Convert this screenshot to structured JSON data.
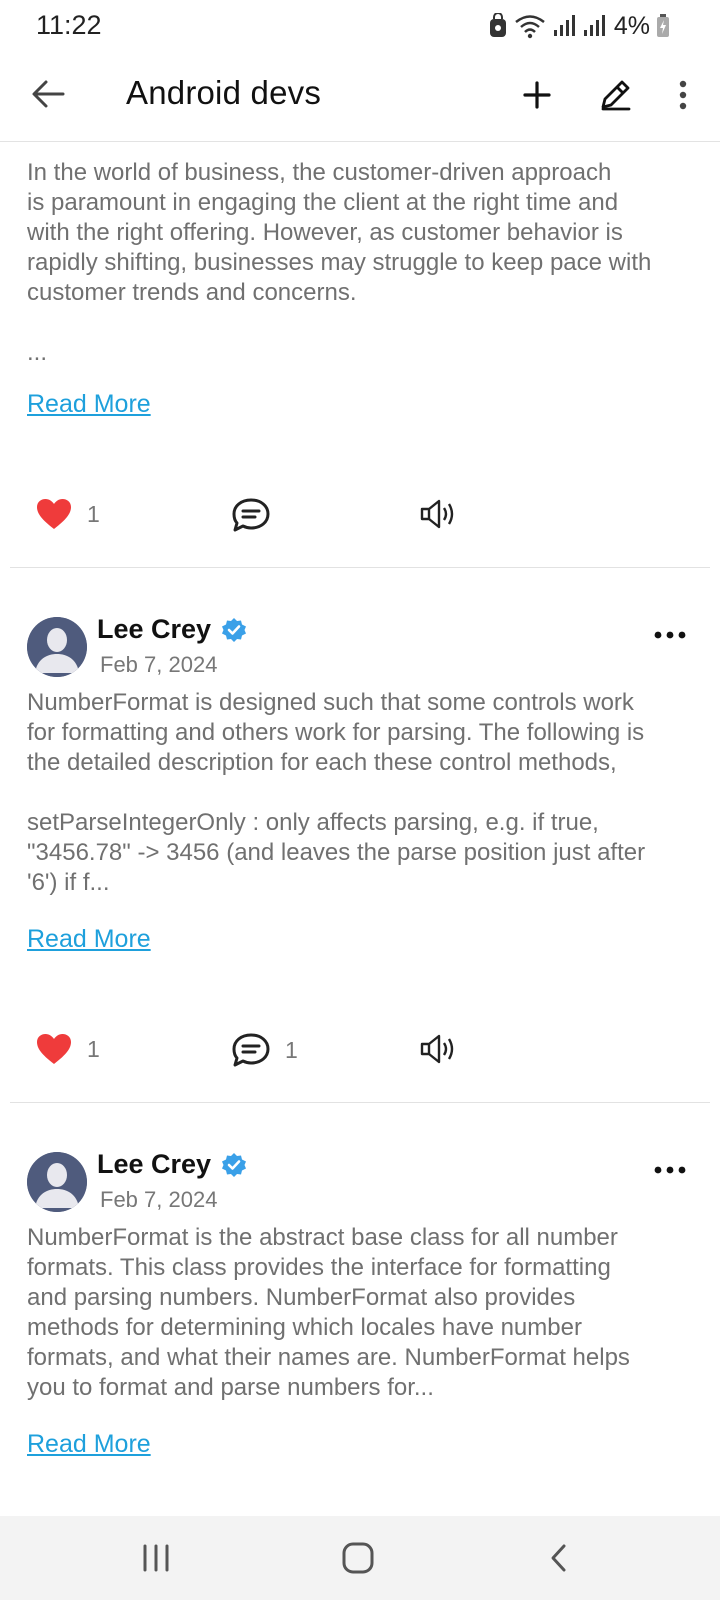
{
  "status_bar": {
    "time": "11:22",
    "battery": "4%"
  },
  "app_bar": {
    "title": "Android devs",
    "icons": [
      "back-arrow-icon",
      "plus-icon",
      "edit-pencil-icon",
      "more-vertical-icon"
    ]
  },
  "posts": [
    {
      "body": "In the world of business, the customer-driven approach\nis paramount in engaging the client at the right time and\nwith the right offering. However, as customer behavior is\nrapidly shifting, businesses may struggle to keep pace with\ncustomer trends and concerns.\n\n...",
      "read_more": "Read More",
      "likes": "1",
      "comments": ""
    },
    {
      "author": "Lee Crey",
      "date": "Feb 7, 2024",
      "body": "NumberFormat is designed such that some controls work\nfor formatting and others work for parsing. The following is\nthe detailed description for each these control methods,\n\nsetParseIntegerOnly : only affects parsing, e.g. if true,\n\"3456.78\" -> 3456 (and leaves the parse position just after\n'6') if f...",
      "read_more": "Read More",
      "likes": "1",
      "comments": "1"
    },
    {
      "author": "Lee Crey",
      "date": "Feb 7, 2024",
      "body": "NumberFormat is the abstract base class for all number\nformats. This class provides the interface for formatting\nand parsing numbers. NumberFormat also provides\nmethods for determining which locales have number\nformats, and what their names are. NumberFormat helps\nyou to format and parse numbers for...",
      "read_more": "Read More"
    }
  ],
  "colors": {
    "accent_link": "#1ea0dc",
    "heart": "#ef3b3b",
    "verified": "#3aa0e8",
    "avatar_bg": "#4f5b7d"
  }
}
